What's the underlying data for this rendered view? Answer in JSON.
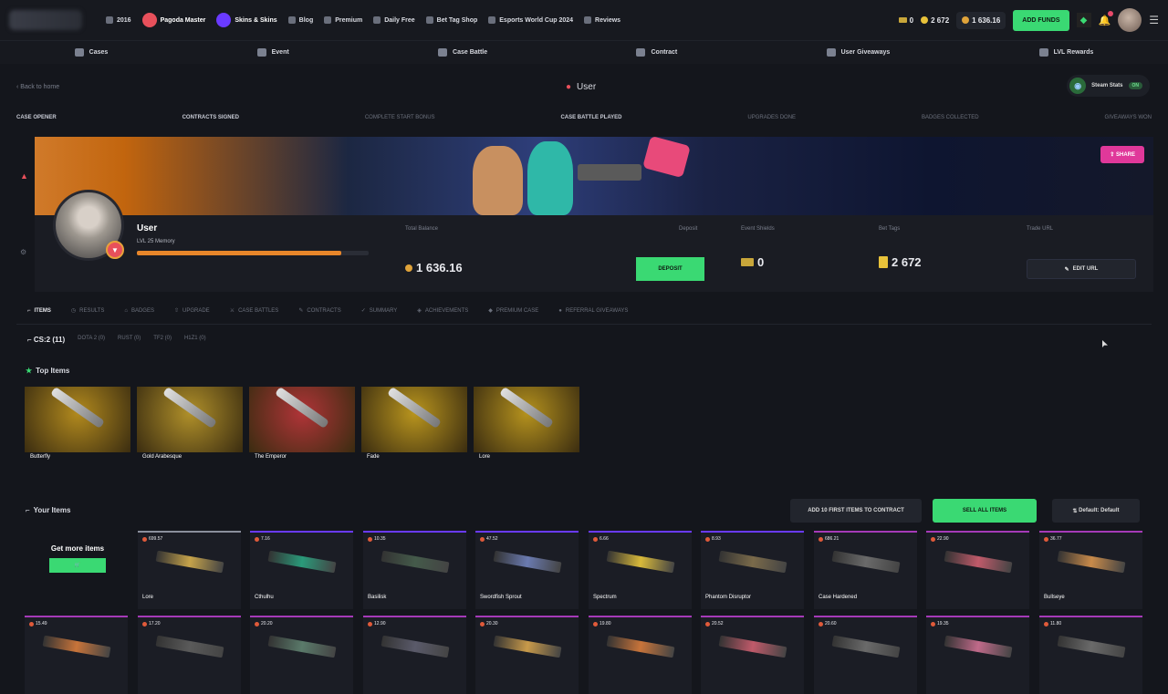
{
  "topbar": {
    "nav": [
      {
        "label": "2016",
        "icon": "hash-icon"
      },
      {
        "label": "Blog",
        "icon": "blog-icon"
      },
      {
        "label": "Premium",
        "icon": "premium-icon"
      },
      {
        "label": "Daily Free",
        "icon": "gift-icon"
      },
      {
        "label": "Bet Tag Shop",
        "icon": "shop-icon"
      },
      {
        "label": "Esports World Cup 2024",
        "icon": "trophy-icon"
      },
      {
        "label": "Reviews",
        "icon": "star-icon"
      }
    ],
    "promos": [
      {
        "title": "Pagoda Master",
        "tag": "",
        "color": "#e8505b"
      },
      {
        "title": "Skins & Skins",
        "tag": "",
        "color": "#6a3aff"
      }
    ],
    "keys": "0",
    "gold": "2 672",
    "balance": "1 636.16",
    "add_funds": "ADD FUNDS",
    "notif_count": "1"
  },
  "subnav": [
    "Cases",
    "Event",
    "Case Battle",
    "Contract",
    "User Giveaways",
    "LVL Rewards"
  ],
  "header": {
    "back": "Back to home",
    "title": "User",
    "steam_label": "Steam Stats",
    "steam_status": "ON"
  },
  "achievements": [
    {
      "tag": "",
      "label": "CASE OPENER"
    },
    {
      "tag": "",
      "label": "CONTRACTS SIGNED"
    },
    {
      "tag": "",
      "label": "COMPLETE START BONUS"
    },
    {
      "tag": "",
      "label": "CASE BATTLE PLAYED"
    },
    {
      "tag": "",
      "label": "UPGRADES DONE"
    },
    {
      "tag": "",
      "label": "BADGES COLLECTED"
    },
    {
      "tag": "",
      "label": "GIVEAWAYS WON"
    }
  ],
  "banner": {
    "share_label": "SHARE"
  },
  "profile": {
    "name": "User",
    "level": "LVL 25 Memory",
    "xp_fraction": 0.88,
    "xp_left": "",
    "xp_right": "",
    "level_badge": "",
    "stats": [
      {
        "label": "Total Balance",
        "value": "1 636.16"
      },
      {
        "label": "Deposit",
        "value": ""
      },
      {
        "label": "Event Shields",
        "value": "0"
      },
      {
        "label": "Bet Tags",
        "value": "2 672"
      },
      {
        "label": "Trade URL",
        "value": ""
      }
    ],
    "deposit_button": "DEPOSIT",
    "edit_url": "EDIT URL"
  },
  "tabs": [
    {
      "label": "ITEMS",
      "active": true
    },
    {
      "label": "RESULTS",
      "active": false
    },
    {
      "label": "BADGES",
      "active": false
    },
    {
      "label": "UPGRADE",
      "active": false
    },
    {
      "label": "CASE BATTLES",
      "active": false
    },
    {
      "label": "CONTRACTS",
      "active": false
    },
    {
      "label": "SUMMARY",
      "active": false
    },
    {
      "label": "ACHIEVEMENTS",
      "active": false
    },
    {
      "label": "PREMIUM CASE",
      "active": false
    },
    {
      "label": "REFERRAL GIVEAWAYS",
      "active": false
    }
  ],
  "game_tabs": [
    {
      "label": "CS:2 (11)",
      "active": true
    },
    {
      "label": "DOTA 2 (0)",
      "active": false
    },
    {
      "label": "RUST (0)",
      "active": false
    },
    {
      "label": "TF2 (0)",
      "active": false
    },
    {
      "label": "H1Z1 (0)",
      "active": false
    }
  ],
  "search_label": "",
  "top_items_title": "Top Items",
  "top_items": [
    {
      "badge": "",
      "wear": "",
      "name": "Butterfly",
      "price": "",
      "bg": "#b28a1e"
    },
    {
      "badge": "",
      "wear": "",
      "name": "Gold Arabesque",
      "price": "",
      "bg": "#b0902a"
    },
    {
      "badge": "",
      "wear": "",
      "name": "The Emperor",
      "price": "",
      "bg": "#b03438"
    },
    {
      "badge": "",
      "wear": "",
      "name": "Fade",
      "price": "",
      "bg": "#b9951e"
    },
    {
      "badge": "",
      "wear": "",
      "name": "Lore",
      "price": "",
      "bg": "#b5921e"
    }
  ],
  "your_items_title": "Your Items",
  "actions": {
    "add_contract": "ADD 10 FIRST ITEMS TO CONTRACT",
    "sell_all": "SELL ALL ITEMS",
    "default": "Default: Default"
  },
  "get_more": {
    "title": "Get more items",
    "subtitle": "",
    "button": ""
  },
  "grid_items": [
    {
      "price": "699.57",
      "fl": "",
      "wear": "",
      "name": "Lore",
      "color": "#c6a34a",
      "border": "#8a8f9c"
    },
    {
      "price": "7.16",
      "fl": "",
      "wear": "",
      "name": "Cthulhu",
      "color": "#2a9a7a",
      "border": "#6a3aff"
    },
    {
      "price": "10.35",
      "fl": "",
      "wear": "",
      "name": "Basilisk",
      "color": "#445a4a",
      "border": "#6a3aff"
    },
    {
      "price": "47.52",
      "fl": "",
      "wear": "",
      "name": "Swordfish Sprout",
      "color": "#6a7ab0",
      "border": "#6a3aff"
    },
    {
      "price": "6.66",
      "fl": "",
      "wear": "",
      "name": "Spectrum",
      "color": "#d8b93a",
      "border": "#6a3aff"
    },
    {
      "price": "8.93",
      "fl": "",
      "wear": "",
      "name": "Phantom Disruptor",
      "color": "#7a6a4a",
      "border": "#6a3aff"
    },
    {
      "price": "686.21",
      "fl": "",
      "wear": "",
      "name": "Case Hardened",
      "color": "#6a6a6a",
      "border": "#a53ab8"
    },
    {
      "price": "22.90",
      "fl": "",
      "wear": "",
      "name": "",
      "color": "#c05a6a",
      "border": "#a53ab8"
    },
    {
      "price": "36.77",
      "fl": "",
      "wear": "",
      "name": "Bullseye",
      "color": "#c88a4a",
      "border": "#a53ab8"
    },
    {
      "price": "15.49",
      "fl": "",
      "wear": "",
      "name": "",
      "color": "#c8743a",
      "border": "#a53ab8"
    },
    {
      "price": "17.20",
      "fl": "",
      "wear": "",
      "name": "",
      "color": "#5a5a5a",
      "border": "#a53ab8"
    },
    {
      "price": "20.20",
      "fl": "",
      "wear": "",
      "name": "",
      "color": "#5a7a6a",
      "border": "#a53ab8"
    },
    {
      "price": "12.90",
      "fl": "",
      "wear": "",
      "name": "",
      "color": "#5a5a6a",
      "border": "#a53ab8"
    },
    {
      "price": "20.30",
      "fl": "",
      "wear": "",
      "name": "",
      "color": "#c89a4a",
      "border": "#a53ab8"
    },
    {
      "price": "19.80",
      "fl": "",
      "wear": "",
      "name": "",
      "color": "#c8743a",
      "border": "#a53ab8"
    },
    {
      "price": "20.52",
      "fl": "",
      "wear": "",
      "name": "",
      "color": "#c05a6a",
      "border": "#a53ab8"
    },
    {
      "price": "20.60",
      "fl": "",
      "wear": "",
      "name": "",
      "color": "#6a6a6a",
      "border": "#a53ab8"
    },
    {
      "price": "19.35",
      "fl": "",
      "wear": "",
      "name": "",
      "color": "#c06a8a",
      "border": "#a53ab8"
    },
    {
      "price": "11.80",
      "fl": "",
      "wear": "",
      "name": "",
      "color": "#6a6a6a",
      "border": "#a53ab8"
    }
  ]
}
